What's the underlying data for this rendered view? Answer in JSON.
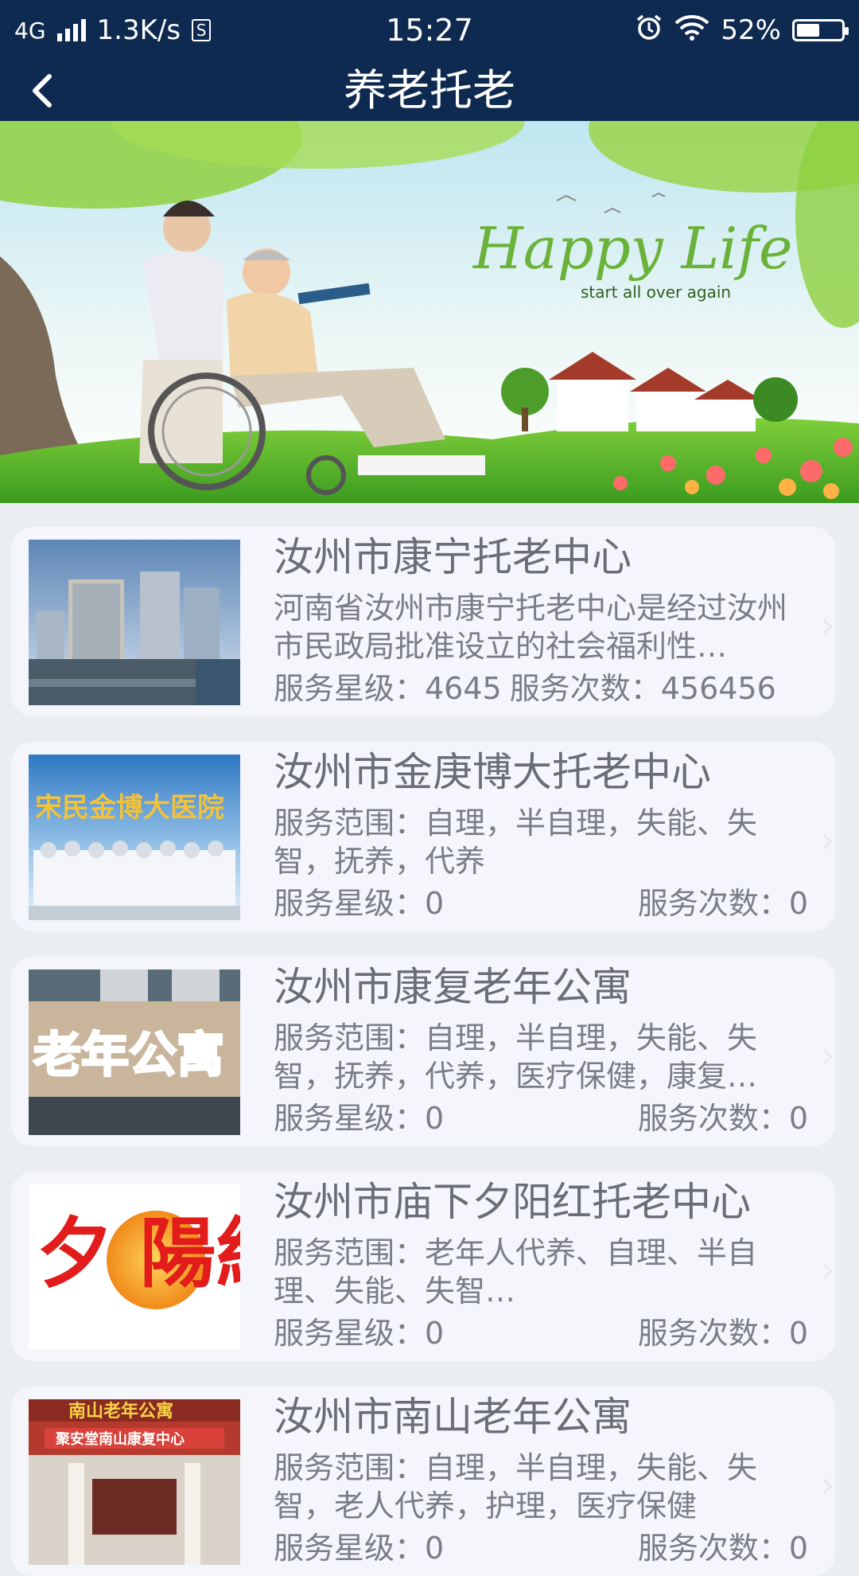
{
  "status_bar": {
    "network": "4G",
    "speed": "1.3K/s",
    "sim_icon": "S",
    "time": "15:27",
    "battery": "52%",
    "battery_level": 0.52
  },
  "header": {
    "title": "养老托老"
  },
  "banner": {
    "headline": "Happy Life",
    "tagline": "start all over again"
  },
  "cards": [
    {
      "title": "汝州市康宁托老中心",
      "desc": "河南省汝州市康宁托老中心是经过汝州市民政局批准设立的社会福利性…",
      "stars": "服务星级：4645",
      "count": "服务次数：456456"
    },
    {
      "title": "汝州市金庚博大托老中心",
      "desc": "服务范围：自理，半自理，失能、失智，抚养，代养",
      "stars": "服务星级：0",
      "count": "服务次数：0",
      "thumb_text": "宋民金博大医院"
    },
    {
      "title": "汝州市康复老年公寓",
      "desc": "服务范围：自理，半自理，失能、失智，抚养，代养，医疗保健，康复…",
      "stars": "服务星级：0",
      "count": "服务次数：0",
      "thumb_text": "老年公寓"
    },
    {
      "title": "汝州市庙下夕阳红托老中心",
      "desc": "服务范围：老年人代养、自理、半自理、失能、失智…",
      "stars": "服务星级：0",
      "count": "服务次数：0",
      "thumb_text": "夕 陽紅"
    },
    {
      "title": "汝州市南山老年公寓",
      "desc": "服务范围：自理，半自理，失能、失智，老人代养，护理，医疗保健",
      "stars": "服务星级：0",
      "count": "服务次数：0",
      "thumb_text": "南山老年公寓",
      "thumb_sub": "聚安堂南山康复中心"
    }
  ],
  "icons": {
    "back": "back-arrow-icon",
    "chevron": "chevron-right-icon",
    "alarm": "alarm-icon",
    "wifi": "wifi-icon",
    "signal": "signal-icon"
  },
  "colors": {
    "header_bg": "#0f2a50",
    "page_bg": "#ebeef1",
    "card_bg": "#f4f6fb"
  }
}
